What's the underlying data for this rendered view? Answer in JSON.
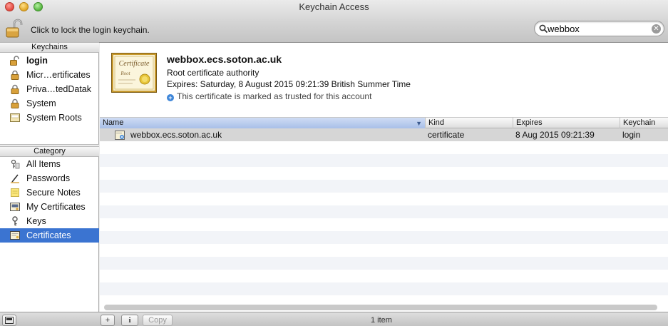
{
  "window": {
    "title": "Keychain Access"
  },
  "toolbar": {
    "lock_text": "Click to lock the login keychain.",
    "search_value": "webbox",
    "search_icon": "search-icon",
    "clear_icon": "clear-icon"
  },
  "sidebar": {
    "keychains_header": "Keychains",
    "keychains": [
      {
        "label": "login",
        "icon": "unlocked-lock-icon",
        "bold": true
      },
      {
        "label": "Micr…ertificates",
        "icon": "lock-icon"
      },
      {
        "label": "Priva…tedDatak",
        "icon": "lock-icon"
      },
      {
        "label": "System",
        "icon": "lock-icon"
      },
      {
        "label": "System Roots",
        "icon": "folder-icon"
      }
    ],
    "category_header": "Category",
    "categories": [
      {
        "label": "All Items",
        "icon": "all-items-icon"
      },
      {
        "label": "Passwords",
        "icon": "password-icon"
      },
      {
        "label": "Secure Notes",
        "icon": "note-icon"
      },
      {
        "label": "My Certificates",
        "icon": "my-certificate-icon"
      },
      {
        "label": "Keys",
        "icon": "key-icon"
      },
      {
        "label": "Certificates",
        "icon": "certificate-icon",
        "selected": true
      }
    ]
  },
  "detail": {
    "name": "webbox.ecs.soton.ac.uk",
    "type": "Root certificate authority",
    "expires": "Expires: Saturday, 8 August 2015 09:21:39 British Summer Time",
    "trust": "This certificate is marked as trusted for this account",
    "thumb_title": "Certificate",
    "thumb_sub": "Root"
  },
  "table": {
    "columns": [
      "Name",
      "Kind",
      "Expires",
      "Keychain"
    ],
    "sorted_column": "Name",
    "rows": [
      {
        "name": "webbox.ecs.soton.ac.uk",
        "kind": "certificate",
        "expires": "8 Aug 2015 09:21:39",
        "keychain": "login"
      }
    ]
  },
  "bottombar": {
    "add_label": "+",
    "info_label": "i",
    "copy_label": "Copy",
    "item_count": "1 item"
  }
}
